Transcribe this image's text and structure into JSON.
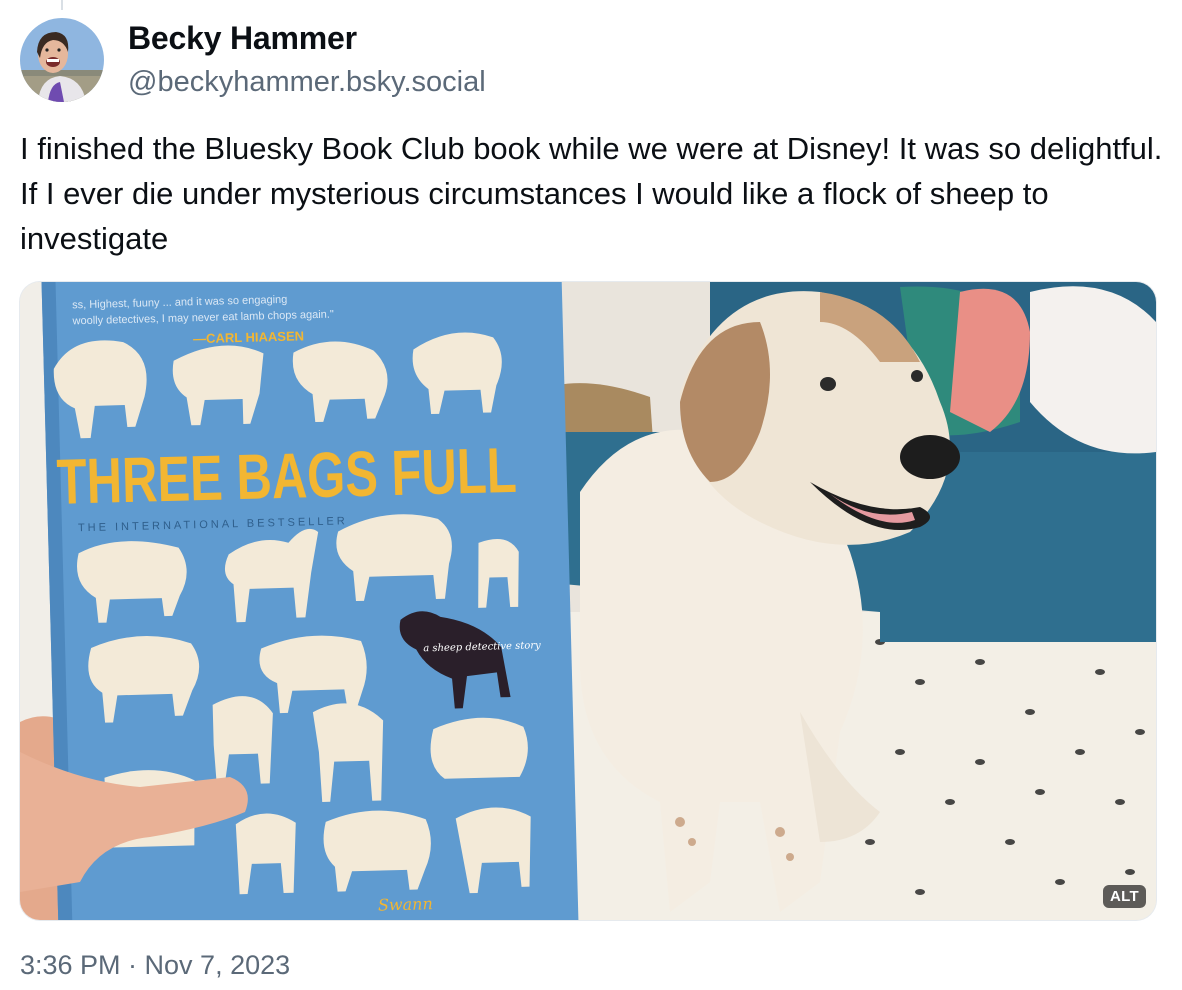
{
  "post": {
    "author": {
      "display_name": "Becky Hammer",
      "handle": "@beckyhammer.bsky.social"
    },
    "text": "I finished the Bluesky Book Club book while we were at Disney! It was so delightful. If I ever die under mysterious circumstances I would like a flock of sheep to investigate",
    "image": {
      "alt_badge": "ALT",
      "book": {
        "blurb_line1": "ss, Highest, fuuny ... and it was so engaging",
        "blurb_line2": "woolly detectives, I may never eat lamb chops again.\"",
        "attribution": "—CARL HIAASEN",
        "title": "THREE BAGS FULL",
        "tagline": "THE INTERNATIONAL BESTSELLER",
        "subtitle": "a sheep detective story",
        "author_fragment": "Swann"
      }
    },
    "timestamp": "3:36 PM · Nov 7, 2023"
  },
  "colors": {
    "book_blue": "#5f9bd0",
    "title_yellow": "#f2b632",
    "sofa_teal": "#2f6f8f",
    "handle_gray": "#5b6978"
  }
}
